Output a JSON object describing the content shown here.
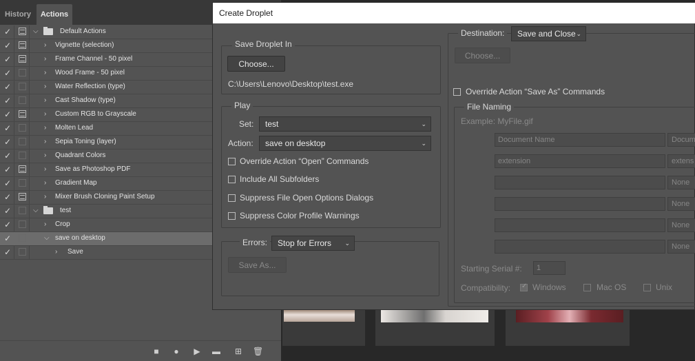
{
  "panel": {
    "tabs": [
      "History",
      "Actions"
    ],
    "rows": [
      {
        "label": "Default Actions",
        "dlg": true,
        "folder": true,
        "open": true,
        "indent": 0
      },
      {
        "label": "Vignette (selection)",
        "dlg": true,
        "indent": 1
      },
      {
        "label": "Frame Channel - 50 pixel",
        "dlg": true,
        "indent": 1
      },
      {
        "label": "Wood Frame - 50 pixel",
        "dlg": false,
        "indent": 1
      },
      {
        "label": "Water Reflection (type)",
        "dlg": false,
        "indent": 1
      },
      {
        "label": "Cast Shadow (type)",
        "dlg": false,
        "indent": 1
      },
      {
        "label": "Custom RGB to Grayscale",
        "dlg": true,
        "indent": 1
      },
      {
        "label": "Molten Lead",
        "dlg": false,
        "indent": 1
      },
      {
        "label": "Sepia Toning (layer)",
        "dlg": false,
        "indent": 1
      },
      {
        "label": "Quadrant Colors",
        "dlg": false,
        "indent": 1
      },
      {
        "label": "Save as Photoshop PDF",
        "dlg": true,
        "indent": 1
      },
      {
        "label": "Gradient Map",
        "dlg": false,
        "indent": 1
      },
      {
        "label": "Mixer Brush Cloning Paint Setup",
        "dlg": true,
        "indent": 1
      },
      {
        "label": "test",
        "dlg": false,
        "folder": true,
        "open": true,
        "indent": 0
      },
      {
        "label": "Crop",
        "dlg": false,
        "indent": 1
      },
      {
        "label": "save on desktop",
        "dlg": false,
        "indent": 1,
        "open": true,
        "selected": true
      },
      {
        "label": "Save",
        "dlg": false,
        "indent": 2
      }
    ],
    "bottom_icons": [
      "stop-icon",
      "record-icon",
      "play-icon",
      "new-set-icon",
      "new-action-icon",
      "delete-icon"
    ]
  },
  "dialog": {
    "title": "Create Droplet",
    "save_in": {
      "title": "Save Droplet In",
      "choose": "Choose...",
      "path": "C:\\Users\\Lenovo\\Desktop\\test.exe"
    },
    "play": {
      "title": "Play",
      "set_label": "Set:",
      "set_value": "test",
      "action_label": "Action:",
      "action_value": "save on desktop",
      "opt1": "Override Action “Open” Commands",
      "opt2": "Include All Subfolders",
      "opt3": "Suppress File Open Options Dialogs",
      "opt4": "Suppress Color Profile Warnings"
    },
    "errors": {
      "label": "Errors:",
      "value": "Stop for Errors",
      "save_as": "Save As..."
    },
    "destination": {
      "label": "Destination:",
      "value": "Save and Close",
      "choose": "Choose...",
      "override": "Override Action “Save As” Commands"
    },
    "naming": {
      "title": "File Naming",
      "example": "Example: MyFile.gif",
      "fields_left": [
        "Document Name",
        "extension",
        "",
        "",
        "",
        ""
      ],
      "fields_right": [
        "Docum",
        "extens",
        "None",
        "None",
        "None",
        "None"
      ],
      "serial_label": "Starting Serial #:",
      "serial_value": "1",
      "compat_label": "Compatibility:",
      "windows": "Windows",
      "macos": "Mac OS",
      "unix": "Unix"
    }
  }
}
